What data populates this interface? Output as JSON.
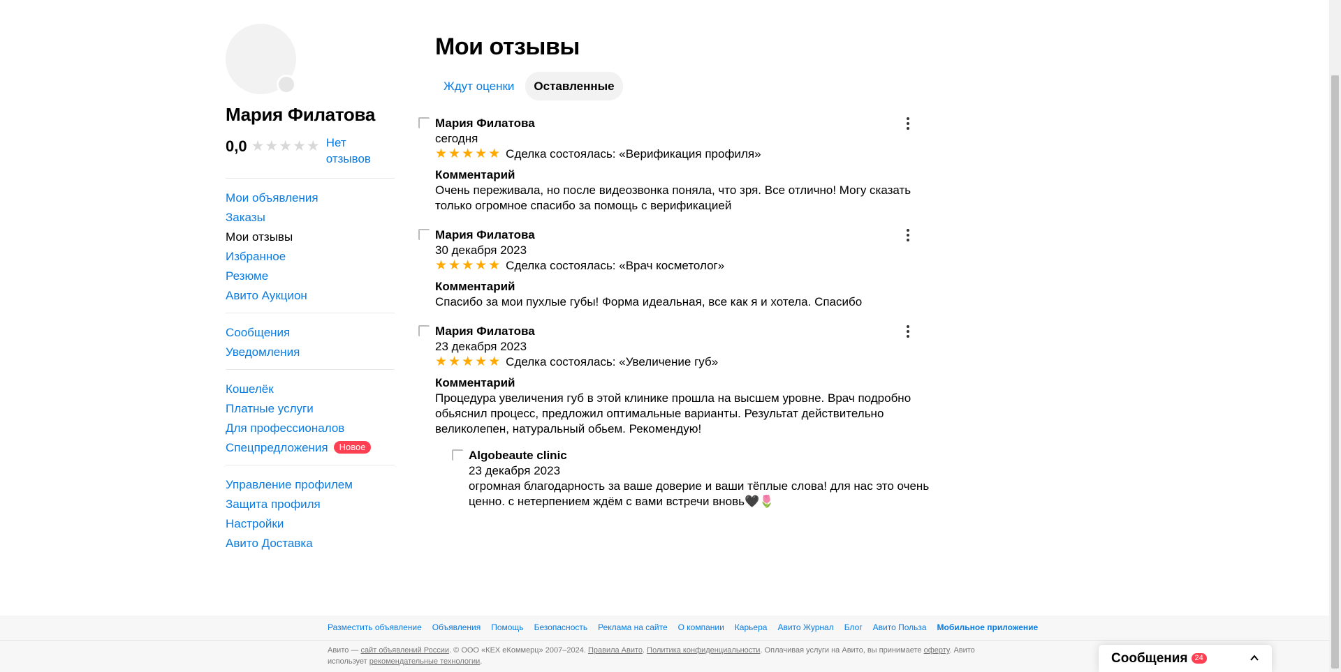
{
  "profile": {
    "name": "Мария Филатова",
    "rating": "0,0",
    "no_reviews": "Нет отзывов"
  },
  "sidebar": {
    "groups": [
      [
        {
          "label": "Мои объявления"
        },
        {
          "label": "Заказы"
        },
        {
          "label": "Мои отзывы",
          "active": true
        },
        {
          "label": "Избранное"
        },
        {
          "label": "Резюме"
        },
        {
          "label": "Авито Аукцион"
        }
      ],
      [
        {
          "label": "Сообщения"
        },
        {
          "label": "Уведомления"
        }
      ],
      [
        {
          "label": "Кошелёк"
        },
        {
          "label": "Платные услуги"
        },
        {
          "label": "Для профессионалов"
        },
        {
          "label": "Спецпредложения",
          "badge": "Новое"
        }
      ],
      [
        {
          "label": "Управление профилем"
        },
        {
          "label": "Защита профиля"
        },
        {
          "label": "Настройки"
        },
        {
          "label": "Авито Доставка"
        }
      ]
    ]
  },
  "main": {
    "title": "Мои отзывы",
    "tabs": [
      {
        "label": "Ждут оценки",
        "active": false
      },
      {
        "label": "Оставленные",
        "active": true
      }
    ],
    "comment_label": "Комментарий",
    "reviews": [
      {
        "author": "Мария Филатова",
        "date": "сегодня",
        "stars": 5,
        "deal": "Сделка состоялась: «Верификация профиля»",
        "comment": "Очень переживала, но после видеозвонка поняла, что зря. Все отлично! Могу сказать только огромное спасибо за помощь с верификацией"
      },
      {
        "author": "Мария Филатова",
        "date": "30 декабря 2023",
        "stars": 5,
        "deal": "Сделка состоялась: «Врач косметолог»",
        "comment": "Спасибо за мои пухлые губы! Форма идеальная, все как я и хотела. Спасибо"
      },
      {
        "author": "Мария Филатова",
        "date": "23 декабря 2023",
        "stars": 5,
        "deal": "Сделка состоялась: «Увеличение губ»",
        "comment": "Процедура увеличения губ в этой клинике прошла на высшем уровне. Врач подробно обьяснил процесс, предложил оптимальные варианты. Результат действительно великолепен, натуральный обьем. Рекомендую!",
        "reply": {
          "author": "Algobeaute clinic",
          "date": "23 декабря 2023",
          "text": "огромная благодарность за ваше доверие и ваши тёплые слова! для нас это очень ценно. с нетерпением ждём с вами встречи вновь🖤🌷"
        }
      }
    ]
  },
  "footer": {
    "links": [
      {
        "label": "Разместить объявление"
      },
      {
        "label": "Объявления"
      },
      {
        "label": "Помощь"
      },
      {
        "label": "Безопасность"
      },
      {
        "label": "Реклама на сайте"
      },
      {
        "label": "О компании"
      },
      {
        "label": "Карьера"
      },
      {
        "label": "Авито Журнал"
      },
      {
        "label": "Блог"
      },
      {
        "label": "Авито Польза"
      },
      {
        "label": "Мобильное приложение",
        "bold": true
      }
    ],
    "legal": {
      "t1": "Авито — ",
      "l1": "сайт объявлений России",
      "t2": ". © ООО «КЕХ еКоммерц» 2007–2024. ",
      "l2": "Правила Авито",
      "t3": ". ",
      "l3": "Политика конфиденциальности",
      "t4": ". Оплачивая услуги на Авито, вы принимаете ",
      "l4": "оферту",
      "t5": ". Авито использует ",
      "l5": "рекомендательные технологии",
      "t6": "."
    }
  },
  "messenger": {
    "title": "Сообщения",
    "count": "24"
  },
  "colors": {
    "link": "#0a7be0",
    "star": "#ffa800",
    "badge": "#ff4053"
  }
}
